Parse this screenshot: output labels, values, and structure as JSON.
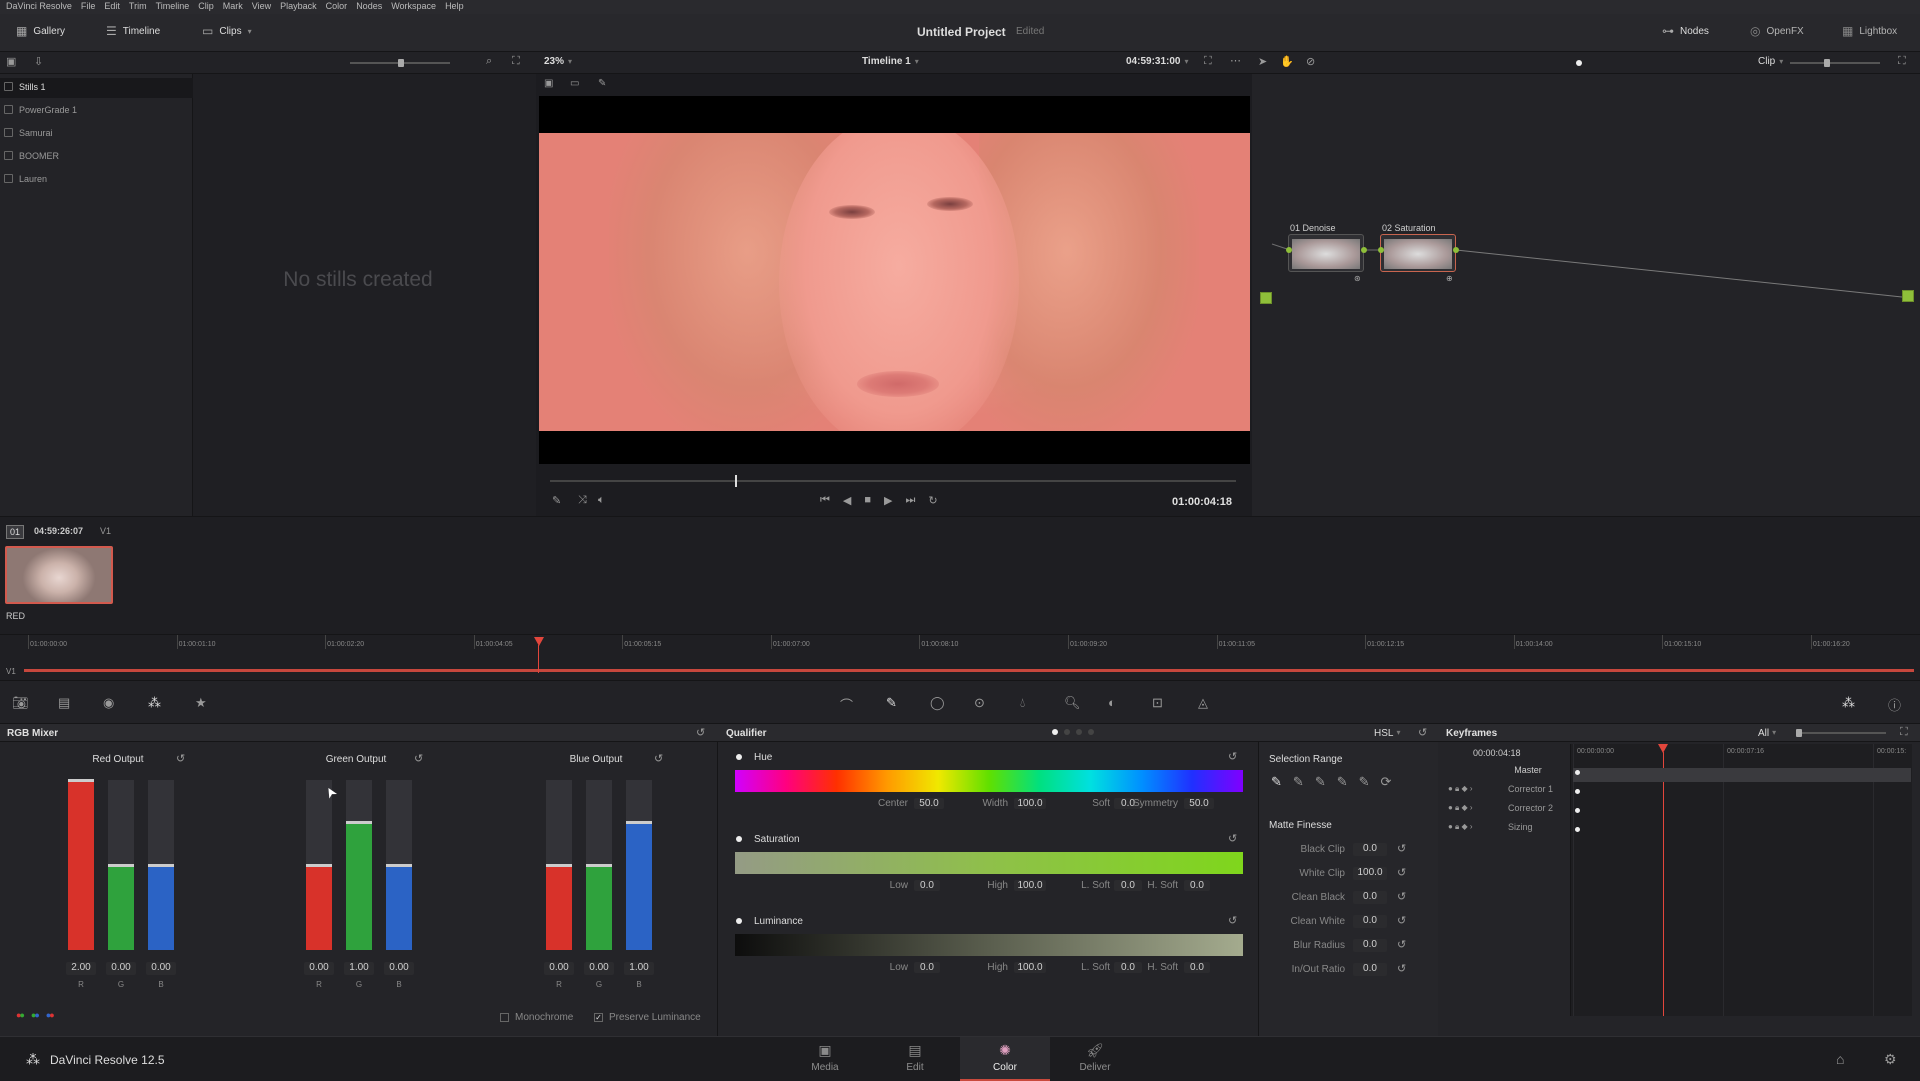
{
  "menubar": {
    "items": [
      "DaVinci Resolve",
      "File",
      "Edit",
      "Trim",
      "Timeline",
      "Clip",
      "Mark",
      "View",
      "Playback",
      "Color",
      "Nodes",
      "Workspace",
      "Help"
    ]
  },
  "toolbar": {
    "gallery": "Gallery",
    "timeline": "Timeline",
    "clips": "Clips",
    "project_title": "Untitled Project",
    "edited": "Edited",
    "nodes": "Nodes",
    "openfx": "OpenFX",
    "lightbox": "Lightbox"
  },
  "viewer_bar": {
    "zoom": "23%",
    "timeline_name": "Timeline 1",
    "timecode": "04:59:31:00",
    "clip_mode": "Clip"
  },
  "gallery": {
    "albums": [
      "Stills 1",
      "PowerGrade 1",
      "Samurai",
      "BOOMER",
      "Lauren"
    ],
    "empty_text": "No stills created"
  },
  "viewer": {
    "playhead_timecode": "01:00:04:18",
    "playhead_progress": 0.27
  },
  "nodes": {
    "node1": "01 Denoise",
    "node2": "02 Saturation"
  },
  "clip_strip": {
    "index": "01",
    "timecode": "04:59:26:07",
    "track": "V1",
    "clip_label": "RED"
  },
  "mini_timeline": {
    "ticks": [
      "01:00:00:00",
      "01:00:01:10",
      "01:00:02:20",
      "01:00:04:05",
      "01:00:05:15",
      "01:00:07:00",
      "01:00:08:10",
      "01:00:09:20",
      "01:00:11:05",
      "01:00:12:15",
      "01:00:14:00",
      "01:00:15:10",
      "01:00:16:20"
    ],
    "track": "V1",
    "playhead_fraction": 0.27
  },
  "rgb_mixer": {
    "title": "RGB Mixer",
    "groups": [
      {
        "name": "Red Output",
        "values": [
          "2.00",
          "0.00",
          "0.00"
        ],
        "levels": [
          1.0,
          0.5,
          0.5
        ]
      },
      {
        "name": "Green Output",
        "values": [
          "0.00",
          "1.00",
          "0.00"
        ],
        "levels": [
          0.5,
          0.75,
          0.5
        ]
      },
      {
        "name": "Blue Output",
        "values": [
          "0.00",
          "0.00",
          "1.00"
        ],
        "levels": [
          0.5,
          0.5,
          0.75
        ]
      }
    ],
    "channel_labels": [
      "R",
      "G",
      "B"
    ],
    "monochrome": "Monochrome",
    "preserve_luminance": "Preserve Luminance"
  },
  "qualifier": {
    "title": "Qualifier",
    "mode": "HSL",
    "hue": {
      "label": "Hue",
      "center_label": "Center",
      "center": "50.0",
      "width_label": "Width",
      "width": "100.0",
      "soft_label": "Soft",
      "soft": "0.0",
      "sym_label": "Symmetry",
      "sym": "50.0"
    },
    "saturation": {
      "label": "Saturation",
      "low_label": "Low",
      "low": "0.0",
      "high_label": "High",
      "high": "100.0",
      "lsoft_label": "L. Soft",
      "lsoft": "0.0",
      "hsoft_label": "H. Soft",
      "hsoft": "0.0"
    },
    "luminance": {
      "label": "Luminance",
      "low_label": "Low",
      "low": "0.0",
      "high_label": "High",
      "high": "100.0",
      "lsoft_label": "L. Soft",
      "lsoft": "0.0",
      "hsoft_label": "H. Soft",
      "hsoft": "0.0"
    },
    "selection_range": "Selection Range",
    "matte_finesse": "Matte Finesse",
    "matte": [
      {
        "label": "Black Clip",
        "value": "0.0"
      },
      {
        "label": "White Clip",
        "value": "100.0"
      },
      {
        "label": "Clean Black",
        "value": "0.0"
      },
      {
        "label": "Clean White",
        "value": "0.0"
      },
      {
        "label": "Blur Radius",
        "value": "0.0"
      },
      {
        "label": "In/Out Ratio",
        "value": "0.0"
      }
    ]
  },
  "keyframes": {
    "title": "Keyframes",
    "filter": "All",
    "current": "00:00:04:18",
    "ticks": [
      "00:00:00:00",
      "00:00:07:16",
      "00:00:15:"
    ],
    "tracks": [
      "Master",
      "Corrector 1",
      "Corrector 2",
      "Sizing"
    ],
    "playhead_fraction": 0.27
  },
  "bottom_nav": {
    "app": "DaVinci Resolve 12.5",
    "pages": [
      "Media",
      "Edit",
      "Color",
      "Deliver"
    ],
    "active": "Color"
  },
  "colors": {
    "accent": "#e2463c",
    "active_tab": "#c94a3d"
  }
}
